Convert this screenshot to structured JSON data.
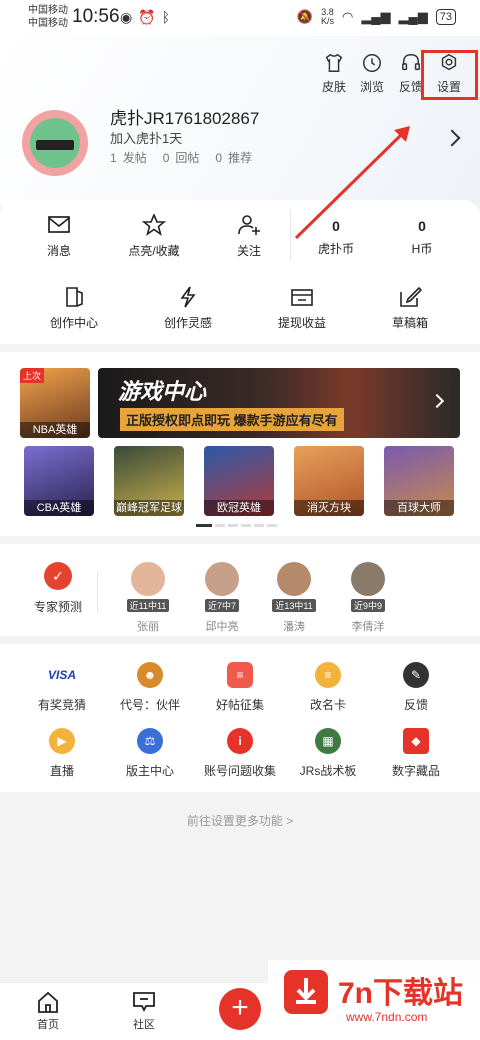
{
  "status_bar": {
    "carrier1": "中国移动",
    "carrier2": "中国移动",
    "time": "10:56",
    "net_speed": "3.8",
    "net_unit": "K/s",
    "battery": "73"
  },
  "header": {
    "actions": [
      {
        "label": "皮肤",
        "icon": "shirt-icon"
      },
      {
        "label": "浏览",
        "icon": "clock-icon"
      },
      {
        "label": "反馈",
        "icon": "headset-icon"
      },
      {
        "label": "设置",
        "icon": "gear-icon"
      }
    ],
    "username": "虎扑JR1761802867",
    "joined": "加入虎扑1天",
    "stats": [
      {
        "value": "1",
        "label": "发帖"
      },
      {
        "value": "0",
        "label": "回帖"
      },
      {
        "value": "0",
        "label": "推荐"
      }
    ]
  },
  "quick_row": {
    "items": [
      "消息",
      "点亮/收藏",
      "关注"
    ],
    "coins": [
      {
        "value": "0",
        "label": "虎扑币"
      },
      {
        "value": "0",
        "label": "H币"
      }
    ]
  },
  "creator_row": [
    "创作中心",
    "创作灵感",
    "提现收益",
    "草稿箱"
  ],
  "games": {
    "main": {
      "tag": "上次",
      "label": "NBA英雄"
    },
    "banner_title": "游戏中心",
    "banner_sub": "正版授权即点即玩 爆款手游应有尽有",
    "thumbs": [
      "CBA英雄",
      "巅峰冠军足球",
      "欧冠英雄",
      "消灭方块",
      "百球大师"
    ]
  },
  "experts": {
    "title": "专家预测",
    "people": [
      {
        "badge": "近11中11",
        "name": "张丽"
      },
      {
        "badge": "近7中7",
        "name": "邱中亮"
      },
      {
        "badge": "近13中11",
        "name": "潘涛"
      },
      {
        "badge": "近9中9",
        "name": "李倩洋"
      }
    ]
  },
  "tools": {
    "row1": [
      {
        "label": "有奖竞猜",
        "icon": "visa-icon",
        "glyph": "VISA",
        "color": "#1a3fb0"
      },
      {
        "label": "代号：伙伴",
        "icon": "luffy-icon",
        "glyph": "☻",
        "color": "#d98a2b"
      },
      {
        "label": "好帖征集",
        "icon": "post-icon",
        "glyph": "≡",
        "color": "#f05a4a"
      },
      {
        "label": "改名卡",
        "icon": "rename-card-icon",
        "glyph": "≡",
        "color": "#f3b33a"
      },
      {
        "label": "反馈",
        "icon": "pen-icon",
        "glyph": "✎",
        "color": "#333333"
      }
    ],
    "row2": [
      {
        "label": "直播",
        "icon": "live-icon",
        "glyph": "▶",
        "color": "#f3b33a"
      },
      {
        "label": "版主中心",
        "icon": "scale-icon",
        "glyph": "⚖",
        "color": "#3a6fd8"
      },
      {
        "label": "账号问题收集",
        "icon": "info-icon",
        "glyph": "i",
        "color": "#e5332a"
      },
      {
        "label": "JRs战术板",
        "icon": "tactics-icon",
        "glyph": "▦",
        "color": "#3f7a44"
      },
      {
        "label": "数字藏品",
        "icon": "gem-icon",
        "glyph": "◆",
        "color": "#e5332a"
      }
    ]
  },
  "more_link": "前往设置更多功能 >",
  "bottom_nav": [
    "首页",
    "社区"
  ],
  "watermark": {
    "title": "7n下载站",
    "url": "www.7ndn.com"
  }
}
